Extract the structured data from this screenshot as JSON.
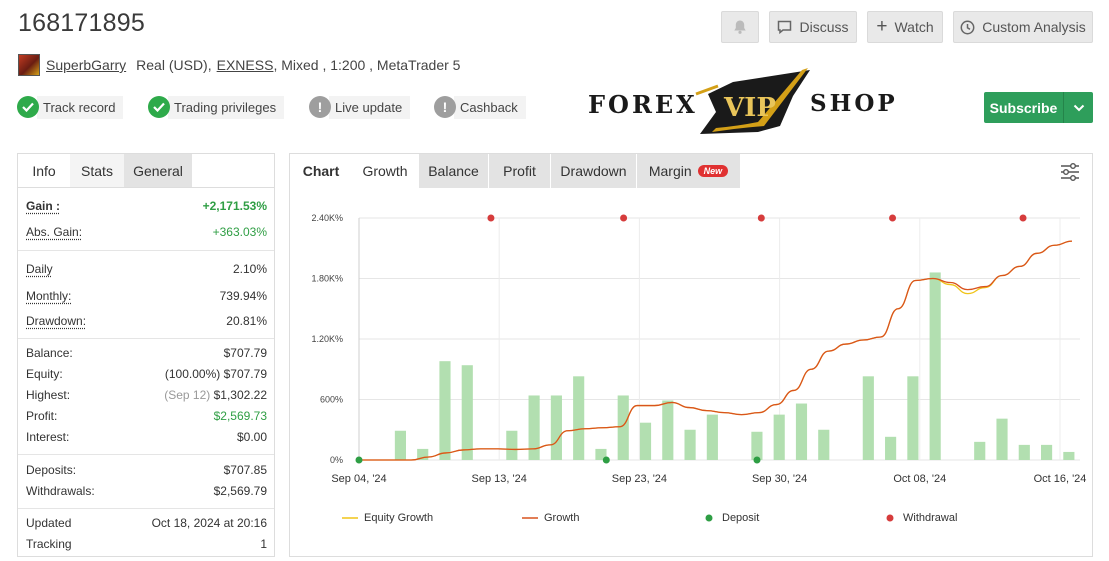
{
  "header": {
    "account_id": "168171895",
    "buttons": {
      "discuss": "Discuss",
      "watch": "Watch",
      "custom_analysis": "Custom Analysis"
    },
    "owner": "SuperbGarry",
    "account_type": "Real (USD),",
    "broker": "EXNESS",
    "details": ", Mixed , 1:200 , MetaTrader 5"
  },
  "badges": [
    {
      "label": "Track record",
      "status": "verified"
    },
    {
      "label": "Trading privileges",
      "status": "verified"
    },
    {
      "label": "Live update",
      "status": "warning"
    },
    {
      "label": "Cashback",
      "status": "warning"
    }
  ],
  "logo": {
    "left": "FOREX",
    "center": "VIP",
    "right": "SHOP"
  },
  "subscribe": {
    "label": "Subscribe"
  },
  "stats": {
    "tabs": [
      "Info",
      "Stats",
      "General"
    ],
    "selected_tab": "Stats",
    "gain": {
      "label": "Gain :",
      "value": "+2,171.53%"
    },
    "abs_gain": {
      "label": "Abs. Gain:",
      "value": "+363.03%"
    },
    "daily": {
      "label": "Daily",
      "value": "2.10%"
    },
    "monthly": {
      "label": "Monthly:",
      "value": "739.94%"
    },
    "drawdown": {
      "label": "Drawdown:",
      "value": "20.81%"
    },
    "balance": {
      "label": "Balance:",
      "value": "$707.79"
    },
    "equity": {
      "label": "Equity:",
      "pct": "(100.00%)",
      "value": "$707.79"
    },
    "highest": {
      "label": "Highest:",
      "date": "(Sep 12)",
      "value": "$1,302.22"
    },
    "profit": {
      "label": "Profit:",
      "value": "$2,569.73"
    },
    "interest": {
      "label": "Interest:",
      "value": "$0.00"
    },
    "deposits": {
      "label": "Deposits:",
      "value": "$707.85"
    },
    "withdrawals": {
      "label": "Withdrawals:",
      "value": "$2,569.79"
    },
    "updated": {
      "label": "Updated",
      "value": "Oct 18, 2024 at 20:16"
    },
    "tracking": {
      "label": "Tracking",
      "value": "1"
    }
  },
  "chart_tabs": {
    "title": "Chart",
    "tabs": [
      "Growth",
      "Balance",
      "Profit",
      "Drawdown",
      "Margin"
    ],
    "selected": "Growth",
    "new_badge": "New"
  },
  "colors": {
    "green": "#2f9e44",
    "accent": "#2e9e5b",
    "growth": "#d9531e",
    "equity": "#f0c419",
    "bars": "#b2dfb0",
    "withdrawal": "#d63c3c",
    "deposit": "#2e9e44"
  },
  "chart_data": {
    "type": "line",
    "y_ticks": [
      "0%",
      "600%",
      "1.20K%",
      "1.80K%",
      "2.40K%"
    ],
    "ylim": [
      0,
      2400
    ],
    "x_ticks": [
      "Sep 04, '24",
      "Sep 13, '24",
      "Sep 23, '24",
      "Sep 30, '24",
      "Oct 08, '24",
      "Oct 16, '24"
    ],
    "series": [
      {
        "name": "Growth",
        "values": [
          0,
          0,
          0,
          0,
          30,
          70,
          100,
          110,
          110,
          105,
          110,
          150,
          290,
          310,
          320,
          330,
          540,
          540,
          570,
          520,
          490,
          470,
          450,
          470,
          550,
          690,
          900,
          1080,
          1150,
          1190,
          1220,
          1500,
          1780,
          1800,
          1760,
          1690,
          1720,
          1830,
          1920,
          2050,
          2130,
          2171
        ]
      },
      {
        "name": "Equity Growth",
        "values": [
          0,
          0,
          0,
          0,
          30,
          70,
          100,
          110,
          110,
          105,
          110,
          150,
          290,
          310,
          320,
          330,
          540,
          540,
          570,
          520,
          490,
          470,
          450,
          470,
          550,
          690,
          900,
          1080,
          1150,
          1190,
          1220,
          1500,
          1780,
          1800,
          1740,
          1650,
          1710,
          1830,
          1920,
          2050,
          2130,
          2171
        ]
      }
    ],
    "bars": [
      0,
      290,
      110,
      980,
      940,
      0,
      290,
      640,
      640,
      830,
      110,
      640,
      370,
      590,
      300,
      450,
      0,
      280,
      450,
      560,
      300,
      0,
      830,
      230,
      830,
      1860,
      0,
      180,
      410,
      150,
      150,
      80
    ],
    "withdrawals_count": 5,
    "deposits_count": 3,
    "legend": [
      "Equity Growth",
      "Growth",
      "Deposit",
      "Withdrawal"
    ]
  }
}
